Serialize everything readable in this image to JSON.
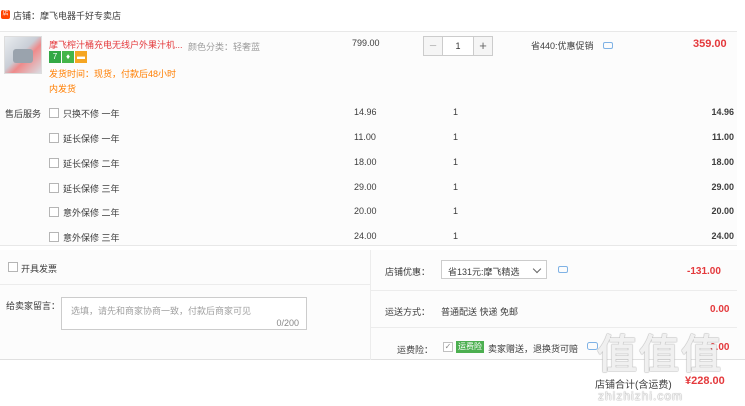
{
  "store": {
    "label": "店铺：摩飞电器千好专卖店",
    "icon": "store-icon"
  },
  "item": {
    "title": "摩飞榨汁桶充电无线户外果汁机...",
    "badges": [
      "7",
      "shield",
      "card"
    ],
    "shipping_line1": "发货时间：现货，付款后48小时",
    "shipping_line2": "内发货",
    "spec": "颜色分类：轻奢蓝",
    "price": "799.00",
    "quantity": "1",
    "promo": "省440:优惠促销",
    "subtotal": "359.00"
  },
  "services": {
    "title": "售后服务",
    "rows": [
      {
        "name": "只换不修  一年",
        "price": "14.96",
        "qty": "1",
        "total": "14.96"
      },
      {
        "name": "延长保修  一年",
        "price": "11.00",
        "qty": "1",
        "total": "11.00"
      },
      {
        "name": "延长保修  二年",
        "price": "18.00",
        "qty": "1",
        "total": "18.00"
      },
      {
        "name": "延长保修  三年",
        "price": "29.00",
        "qty": "1",
        "total": "29.00"
      },
      {
        "name": "意外保修  二年",
        "price": "20.00",
        "qty": "1",
        "total": "20.00"
      },
      {
        "name": "意外保修  三年",
        "price": "24.00",
        "qty": "1",
        "total": "24.00"
      }
    ]
  },
  "invoice": {
    "label": "开具发票"
  },
  "message": {
    "label": "给卖家留言：",
    "placeholder": "选填，请先和商家协商一致，付款后商家可见",
    "count": "0/200"
  },
  "store_coupon": {
    "label": "店铺优惠：",
    "selected": "省131元:摩飞精选",
    "value": "-131.00"
  },
  "delivery": {
    "label": "运送方式：",
    "option": "普通配送 快递 免邮",
    "value": "0.00"
  },
  "insurance": {
    "label": "运费险：",
    "tag": "运费险",
    "desc": "卖家赠送，退换货可赔",
    "value": "0.00"
  },
  "total": {
    "label": "店铺合计(含运费)",
    "value": "¥228.00"
  },
  "watermark": {
    "big": "值值值",
    "small": "zhizhizhi.com"
  },
  "colors": {
    "accent": "#e4393c",
    "orange": "#ff7e00",
    "border": "#cccccc"
  }
}
